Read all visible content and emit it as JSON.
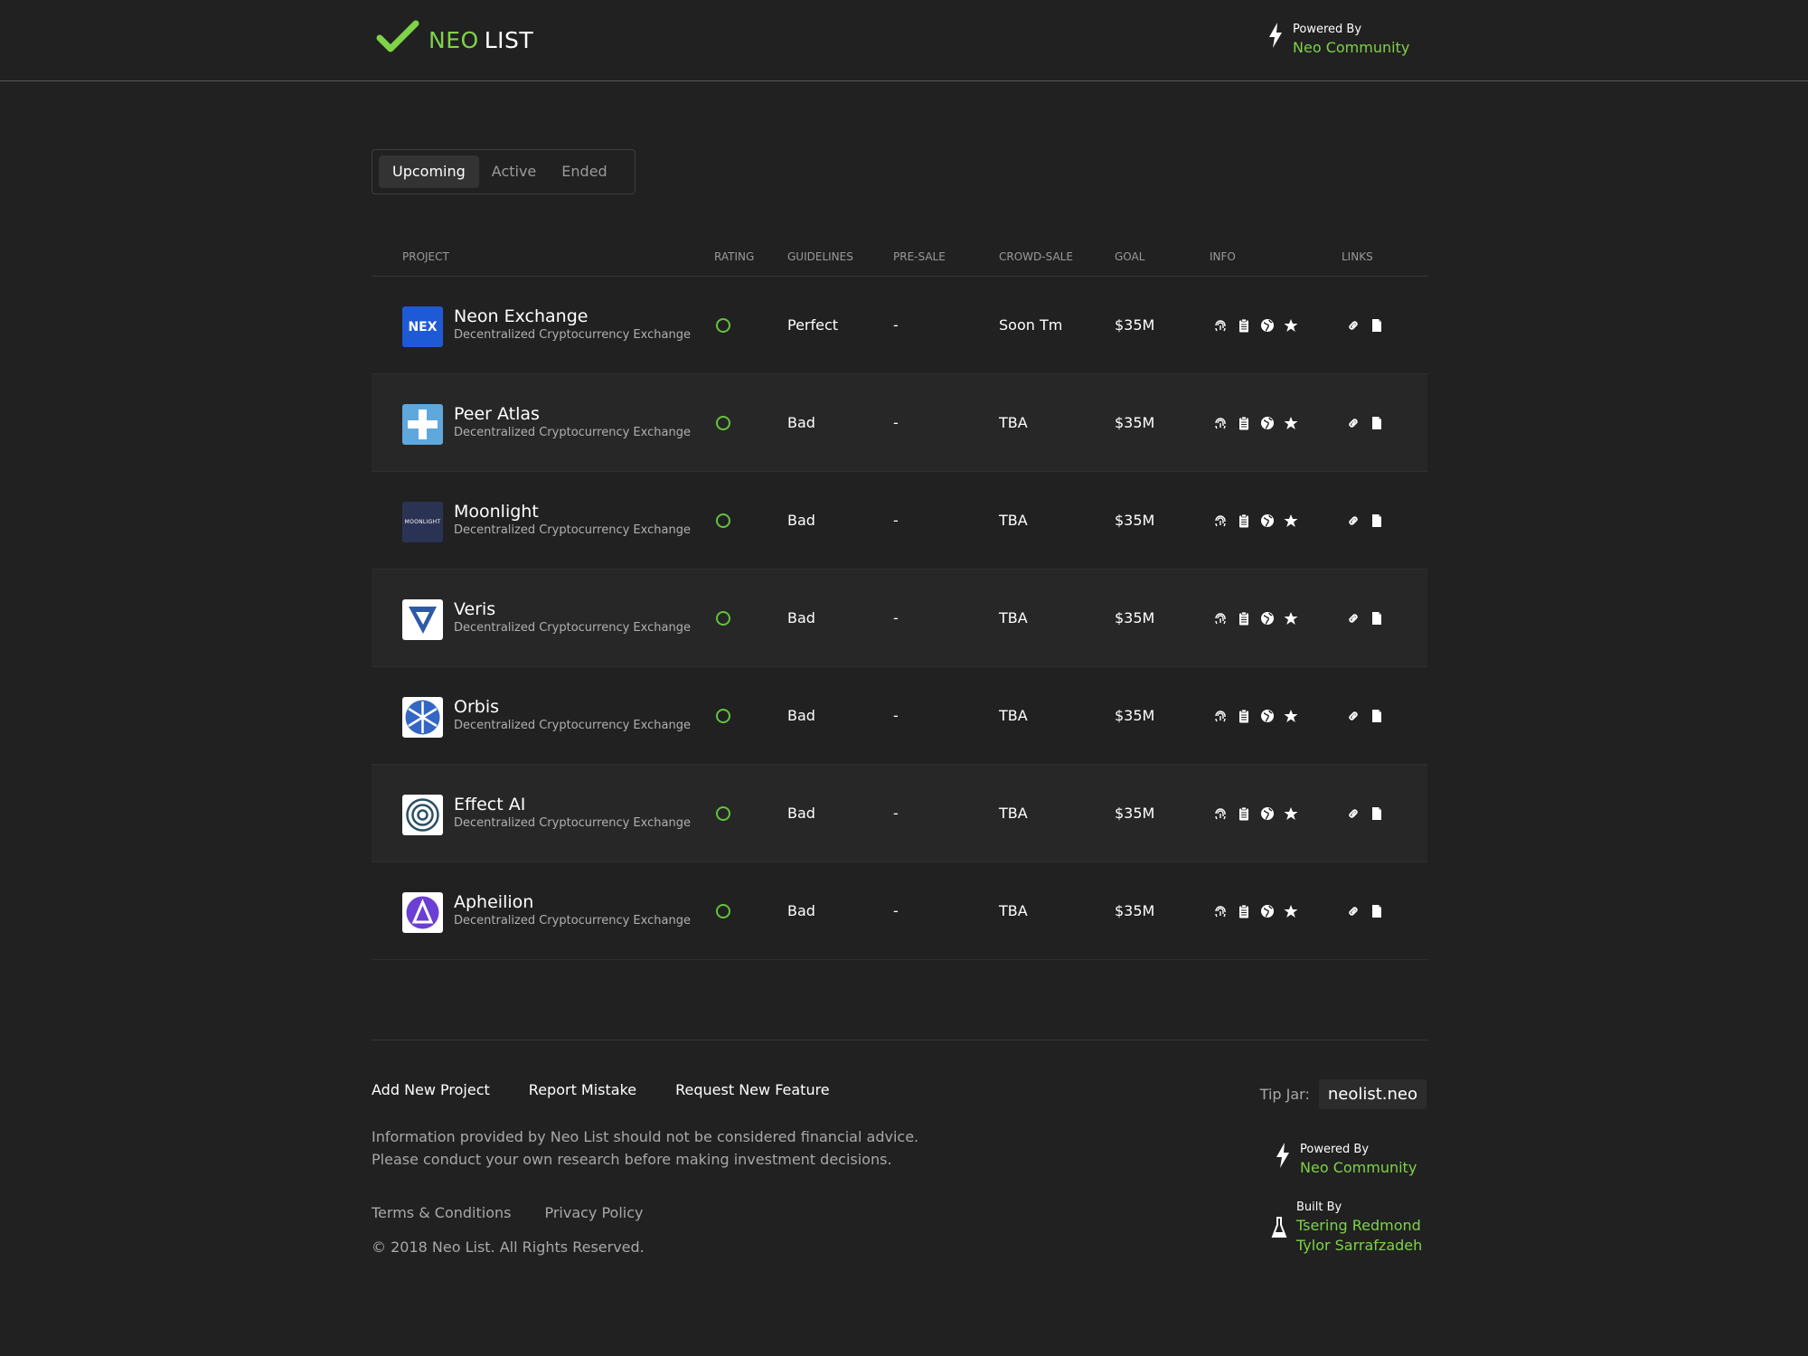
{
  "header": {
    "logo_neo": "NEO",
    "logo_list": "LIST",
    "powered_label": "Powered By",
    "powered_link": "Neo Community"
  },
  "tabs": [
    {
      "label": "Upcoming",
      "active": true
    },
    {
      "label": "Active",
      "active": false
    },
    {
      "label": "Ended",
      "active": false
    }
  ],
  "table": {
    "columns": [
      "PROJECT",
      "RATING",
      "GUIDELINES",
      "PRE-SALE",
      "CROWD-SALE",
      "GOAL",
      "INFO",
      "LINKS"
    ],
    "rows": [
      {
        "name": "Neon Exchange",
        "desc": "Decentralized Cryptocurrency Exchange",
        "guidelines": "Perfect",
        "presale": "-",
        "crowdsale": "Soon Tm",
        "goal": "$35M",
        "logo_text": "NEX"
      },
      {
        "name": "Peer Atlas",
        "desc": "Decentralized Cryptocurrency Exchange",
        "guidelines": "Bad",
        "presale": "-",
        "crowdsale": "TBA",
        "goal": "$35M"
      },
      {
        "name": "Moonlight",
        "desc": "Decentralized Cryptocurrency Exchange",
        "guidelines": "Bad",
        "presale": "-",
        "crowdsale": "TBA",
        "goal": "$35M",
        "logo_text": "MOONLIGHT"
      },
      {
        "name": "Veris",
        "desc": "Decentralized Cryptocurrency Exchange",
        "guidelines": "Bad",
        "presale": "-",
        "crowdsale": "TBA",
        "goal": "$35M"
      },
      {
        "name": "Orbis",
        "desc": "Decentralized Cryptocurrency Exchange",
        "guidelines": "Bad",
        "presale": "-",
        "crowdsale": "TBA",
        "goal": "$35M"
      },
      {
        "name": "Effect AI",
        "desc": "Decentralized Cryptocurrency Exchange",
        "guidelines": "Bad",
        "presale": "-",
        "crowdsale": "TBA",
        "goal": "$35M"
      },
      {
        "name": "Apheilion",
        "desc": "Decentralized Cryptocurrency Exchange",
        "guidelines": "Bad",
        "presale": "-",
        "crowdsale": "TBA",
        "goal": "$35M"
      }
    ],
    "info_icons": [
      "fingerprint-icon",
      "clipboard-icon",
      "globe-icon",
      "star-icon"
    ],
    "link_icons": [
      "link-icon",
      "document-icon"
    ]
  },
  "footer": {
    "links": [
      "Add New Project",
      "Report Mistake",
      "Request New Feature"
    ],
    "disclaimer_1": "Information provided by Neo List should not be considered financial advice.",
    "disclaimer_2": "Please conduct your own research before making investment decisions.",
    "terms": "Terms & Conditions",
    "privacy": "Privacy Policy",
    "copyright": "© 2018 Neo List. All Rights Reserved.",
    "tipjar_label": "Tip Jar:",
    "tipjar_value": "neolist.neo",
    "powered_label": "Powered By",
    "powered_link": "Neo Community",
    "built_label": "Built By",
    "builders": [
      "Tsering Redmond",
      "Tylor Sarrafzadeh"
    ]
  },
  "colors": {
    "accent": "#7ed348",
    "background": "#212121",
    "row_alt": "#272727",
    "rating": "#63c43d"
  }
}
